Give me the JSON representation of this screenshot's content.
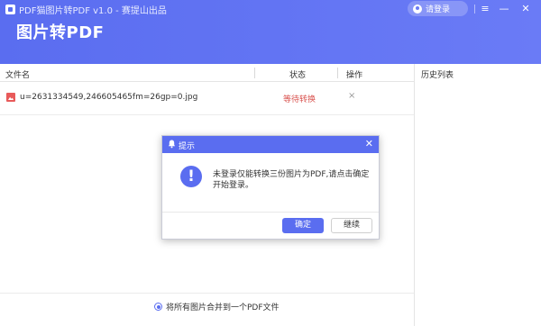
{
  "window": {
    "title": "PDF猫图片转PDF v1.0 - 赛提山出品",
    "heading": "图片转PDF",
    "login_label": "请登录",
    "controls": {
      "menu": "≡",
      "minimize": "—",
      "close": "✕"
    }
  },
  "table": {
    "headers": {
      "file_name": "文件名",
      "status": "状态",
      "action": "操作"
    },
    "rows": [
      {
        "name": "u=2631334549,246605465fm=26gp=0.jpg",
        "status": "等待转换",
        "remove": "×"
      }
    ]
  },
  "history": {
    "title": "历史列表"
  },
  "merge_option": {
    "label": "将所有图片合并到一个PDF文件",
    "selected": true
  },
  "dialog": {
    "title": "提示",
    "close": "✕",
    "icon_glyph": "!",
    "message": "未登录仅能转换三份图片为PDF,请点击确定开始登录。",
    "ok_label": "确定",
    "continue_label": "继续"
  },
  "colors": {
    "accent": "#5a6df0",
    "status_pending": "#d9534f"
  }
}
